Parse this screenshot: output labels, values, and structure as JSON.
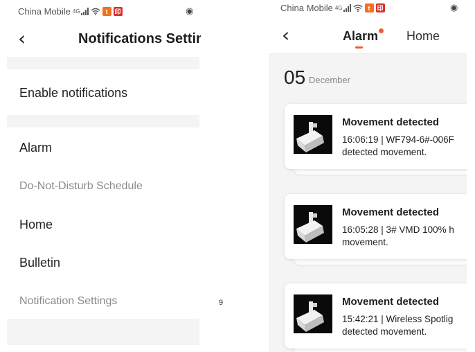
{
  "status_bar": {
    "carrier": "China Mobile",
    "network": "4G",
    "badges": [
      {
        "label": "t",
        "color": "#f2711c"
      },
      {
        "label": "印",
        "color": "#d9312b"
      }
    ],
    "eye_icon": "eye-icon"
  },
  "left": {
    "title": "Notifications Settin",
    "back_icon": "back-chevron-icon",
    "enable_notifications": "Enable notifications",
    "items": [
      {
        "label": "Alarm"
      },
      {
        "label": "Do-Not-Disturb Schedule"
      },
      {
        "label": "Home"
      },
      {
        "label": "Bulletin"
      },
      {
        "label": "Notification Settings"
      }
    ]
  },
  "page_number": "9",
  "right": {
    "back_icon": "back-chevron-icon",
    "tabs": [
      {
        "label": "Alarm",
        "active": true,
        "has_dot": true
      },
      {
        "label": "Home",
        "active": false
      }
    ],
    "accent_color": "#f25c2a",
    "date": {
      "day": "05",
      "month": "December"
    },
    "events": [
      {
        "title": "Movement detected",
        "line1": "16:06:19 | WF794-6#-006F",
        "line2": "detected movement."
      },
      {
        "title": "Movement detected",
        "line1": "16:05:28 | 3# VMD 100% h",
        "line2": "movement."
      },
      {
        "title": "Movement detected",
        "line1": "15:42:21 | Wireless Spotlig",
        "line2": "detected movement."
      }
    ]
  }
}
